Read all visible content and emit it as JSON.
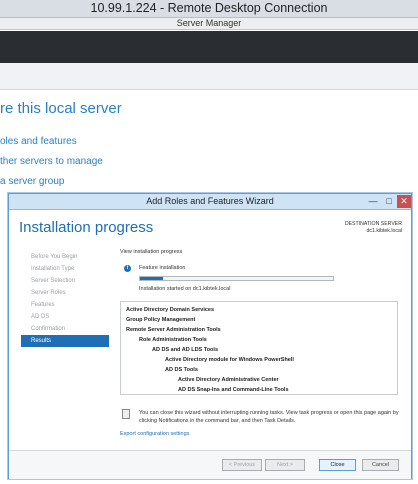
{
  "rdc": {
    "title": "10.99.1.224 - Remote Desktop Connection"
  },
  "server_manager": {
    "title": "Server Manager",
    "heading": "re this local server",
    "links": [
      "oles and features",
      "ther servers to manage",
      "a server group"
    ]
  },
  "wizard": {
    "title": "Add Roles and Features Wizard",
    "controls": {
      "minimize": "—",
      "maximize": "□",
      "close": "✕"
    },
    "heading": "Installation progress",
    "destination_label": "DESTINATION SERVER",
    "destination_server": "dc1.kibtek.local",
    "nav": [
      {
        "label": "Before You Begin",
        "active": false
      },
      {
        "label": "Installation Type",
        "active": false
      },
      {
        "label": "Server Selection",
        "active": false
      },
      {
        "label": "Server Roles",
        "active": false
      },
      {
        "label": "Features",
        "active": false
      },
      {
        "label": "AD DS",
        "active": false
      },
      {
        "label": "Confirmation",
        "active": false
      },
      {
        "label": "Results",
        "active": true
      }
    ],
    "view_label": "View installation progress",
    "info_icon": "i",
    "feature_installation_label": "Feature installation",
    "progress_fraction": 0.12,
    "install_started": "Installation started on dc1.kibtek.local",
    "features": [
      {
        "text": "Active Directory Domain Services",
        "level": 0
      },
      {
        "text": "Group Policy Management",
        "level": 0
      },
      {
        "text": "Remote Server Administration Tools",
        "level": 0
      },
      {
        "text": "Role Administration Tools",
        "level": 1
      },
      {
        "text": "AD DS and AD LDS Tools",
        "level": 2
      },
      {
        "text": "Active Directory module for Windows PowerShell",
        "level": 3
      },
      {
        "text": "AD DS Tools",
        "level": 3
      },
      {
        "text": "Active Directory Administrative Center",
        "level": 4
      },
      {
        "text": "AD DS Snap-Ins and Command-Line Tools",
        "level": 4
      }
    ],
    "note": "You can close this wizard without interrupting running tasks. View task progress or open this page again by clicking Notifications in the command bar, and then Task Details.",
    "export_link": "Export configuration settings",
    "buttons": {
      "previous": "< Previous",
      "next": "Next >",
      "close": "Close",
      "cancel": "Cancel"
    }
  },
  "colors": {
    "accent": "#1e6fb5",
    "link": "#2b7fc6",
    "dark_band": "#2a2e33"
  }
}
